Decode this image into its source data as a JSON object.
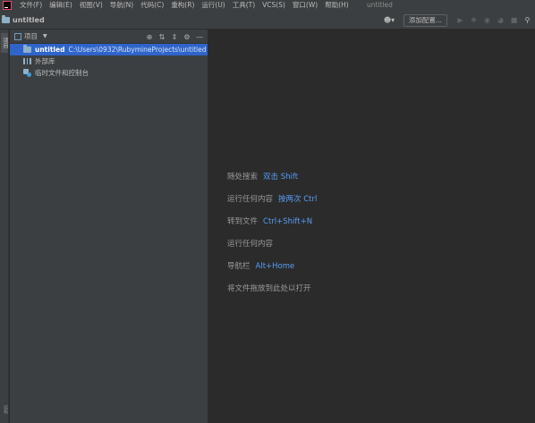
{
  "menubar": {
    "items": [
      "文件(F)",
      "编辑(E)",
      "视图(V)",
      "导航(N)",
      "代码(C)",
      "重构(R)",
      "运行(U)",
      "工具(T)",
      "VCS(S)",
      "窗口(W)",
      "帮助(H)"
    ],
    "window_title": "untitled"
  },
  "navbar": {
    "breadcrumb": "untitled",
    "add_config_label": "添加配置..."
  },
  "left_strip": {
    "project_tab": "项目",
    "bottom_tab": "结构"
  },
  "project_panel": {
    "title": "项目",
    "tree": [
      {
        "name": "untitled",
        "path": "C:\\Users\\0932\\RubymineProjects\\untitled"
      },
      {
        "name": "外部库"
      },
      {
        "name": "临时文件和控制台"
      }
    ]
  },
  "editor": {
    "hints": [
      {
        "label": "随处搜索",
        "shortcut": "双击 Shift"
      },
      {
        "label": "运行任何内容",
        "shortcut": "按两次 Ctrl"
      },
      {
        "label": "转到文件",
        "shortcut": "Ctrl+Shift+N"
      },
      {
        "label": "运行任何内容",
        "shortcut": ""
      },
      {
        "label": "导航栏",
        "shortcut": "Alt+Home"
      },
      {
        "label": "将文件拖放到此处以打开",
        "shortcut": ""
      }
    ]
  },
  "colors": {
    "accent": "#589df6",
    "selection": "#2f65ca",
    "panel_bg": "#3c3f41",
    "editor_bg": "#2b2b2b"
  }
}
